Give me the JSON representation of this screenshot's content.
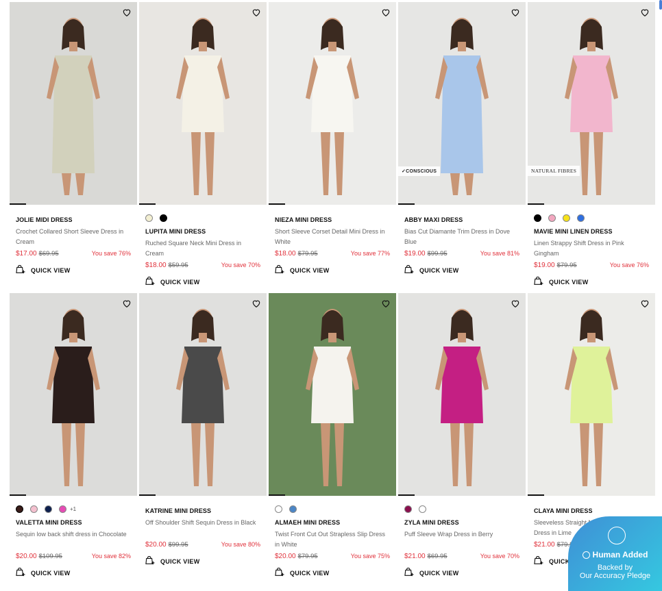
{
  "products": [
    {
      "name": "JOLIE MIDI DRESS",
      "desc": "Crochet Collared Short Sleeve Dress in Cream",
      "price": "$17.00",
      "was": "$69.95",
      "save": "You save 76%",
      "quick_view": "QUICK VIEW",
      "bg": "#d9d9d6",
      "dress": "#d2d1bc",
      "swatches": [],
      "more": "",
      "badge": ""
    },
    {
      "name": "LUPITA MINI DRESS",
      "desc": "Ruched Square Neck Mini Dress in Cream",
      "price": "$18.00",
      "was": "$59.95",
      "save": "You save 70%",
      "quick_view": "QUICK VIEW",
      "bg": "#e8e6e2",
      "dress": "#f4f1e6",
      "swatches": [
        "#f3efd2",
        "#000000"
      ],
      "more": "",
      "badge": ""
    },
    {
      "name": "NIEZA MINI DRESS",
      "desc": "Short Sleeve Corset Detail Mini Dress in White",
      "price": "$18.00",
      "was": "$79.95",
      "save": "You save 77%",
      "quick_view": "QUICK VIEW",
      "bg": "#ececea",
      "dress": "#f7f6f1",
      "swatches": [],
      "more": "",
      "badge": ""
    },
    {
      "name": "ABBY MAXI DRESS",
      "desc": "Bias Cut Diamante Trim Dress in Dove Blue",
      "price": "$19.00",
      "was": "$99.95",
      "save": "You save 81%",
      "quick_view": "QUICK VIEW",
      "bg": "#e6e6e4",
      "dress": "#a9c6ea",
      "swatches": [],
      "more": "",
      "badge": "✓CONSCIOUS"
    },
    {
      "name": "MAVIE MINI LINEN DRESS",
      "desc": "Linen Strappy Shift Dress in Pink Gingham",
      "price": "$19.00",
      "was": "$79.95",
      "save": "You save 76%",
      "quick_view": "QUICK VIEW",
      "bg": "#e7e7e5",
      "dress": "#f2b6cd",
      "swatches": [
        "#000000",
        "#f2a7bf",
        "#f7e21a",
        "#2f6fe0"
      ],
      "more": "",
      "badge": "NATURAL FIBRES"
    },
    {
      "name": "VALETTA MINI DRESS",
      "desc": "Sequin low back shift dress in Chocolate",
      "price": "$20.00",
      "was": "$109.95",
      "save": "You save 82%",
      "quick_view": "QUICK VIEW",
      "bg": "#dcdcda",
      "dress": "#2a1d1b",
      "swatches": [
        "#3a1d1a",
        "#f4c0cf",
        "#0d1f4d",
        "#e64cb5"
      ],
      "more": "+1",
      "badge": ""
    },
    {
      "name": "KATRINE MINI DRESS",
      "desc": "Off Shoulder Shift Sequin Dress in Black",
      "price": "$20.00",
      "was": "$99.95",
      "save": "You save 80%",
      "quick_view": "QUICK VIEW",
      "bg": "#e0e0de",
      "dress": "#4a4a4a",
      "swatches": [],
      "more": "",
      "badge": ""
    },
    {
      "name": "ALMAEH MINI DRESS",
      "desc": "Twist Front Cut Out Strapless Slip Dress in White",
      "price": "$20.00",
      "was": "$79.95",
      "save": "You save 75%",
      "quick_view": "QUICK VIEW",
      "bg": "#6a8a5a",
      "dress": "#f5f3ee",
      "swatches": [
        "#ffffff",
        "#4c86c6"
      ],
      "more": "",
      "badge": ""
    },
    {
      "name": "ZYLA MINI DRESS",
      "desc": "Puff Sleeve Wrap Dress in Berry",
      "price": "$21.00",
      "was": "$69.95",
      "save": "You save 70%",
      "quick_view": "QUICK VIEW",
      "bg": "#e3e3e1",
      "dress": "#c41f83",
      "swatches": [
        "#8a0f4e",
        "#ffffff"
      ],
      "more": "",
      "badge": ""
    },
    {
      "name": "CLAYA MINI DRESS",
      "desc": "Sleeveless Straight Neck Floral Detail Dress in Lime",
      "price": "$21.00",
      "was": "$79.95",
      "save": "",
      "quick_view": "QUICK VIEW",
      "bg": "#ecece9",
      "dress": "#dff29a",
      "swatches": [],
      "more": "",
      "badge": ""
    }
  ],
  "pledge": {
    "title": "Human Added",
    "line1": "Backed by",
    "line2": "Our Accuracy Pledge"
  }
}
